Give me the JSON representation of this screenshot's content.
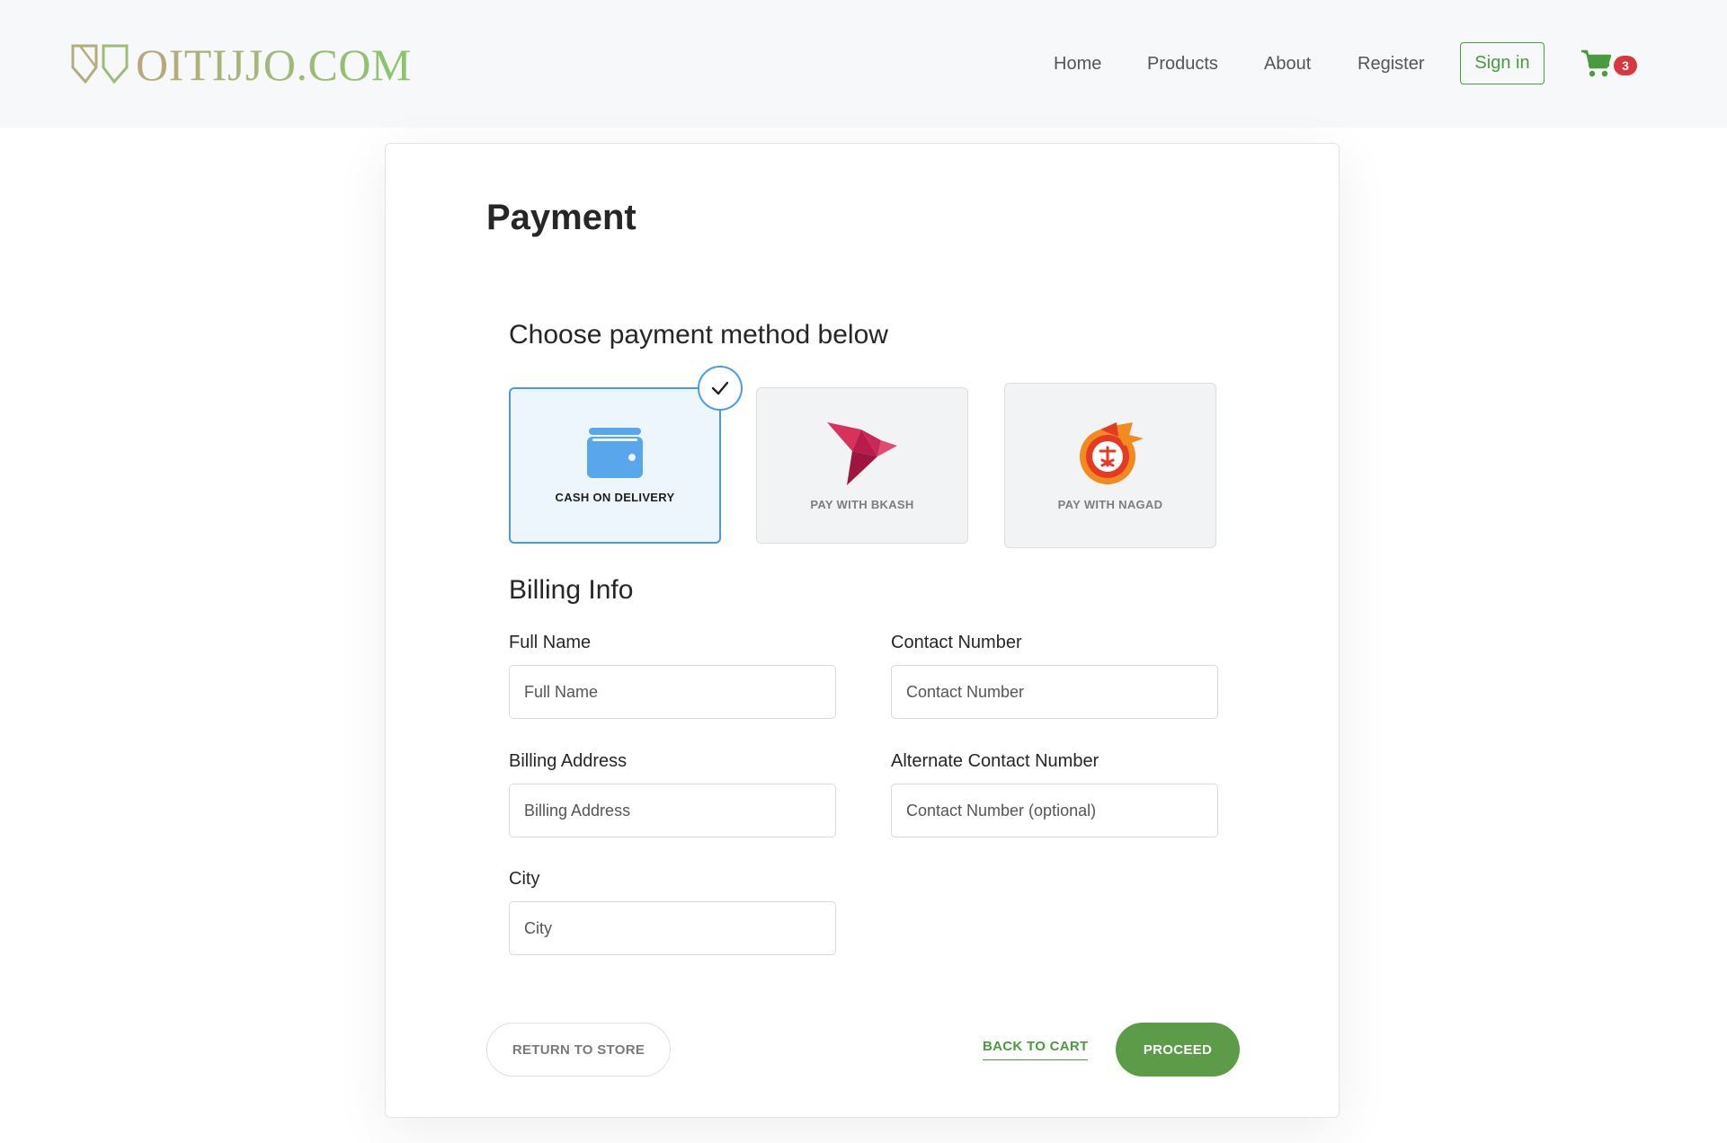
{
  "header": {
    "brand": "OITIJJO.COM",
    "nav": {
      "home": "Home",
      "products": "Products",
      "about": "About",
      "register": "Register"
    },
    "sign_in": "Sign in",
    "cart_count": "3",
    "brand_color": "#4a9a3e"
  },
  "payment": {
    "title": "Payment",
    "choose_title": "Choose payment method below",
    "options": [
      {
        "label": "CASH ON DELIVERY",
        "icon": "wallet-icon",
        "selected": true
      },
      {
        "label": "PAY WITH BKASH",
        "icon": "bkash-logo-icon",
        "selected": false
      },
      {
        "label": "PAY WITH NAGAD",
        "icon": "nagad-logo-icon",
        "selected": false
      }
    ],
    "selected_color": "#4a9ae3"
  },
  "billing": {
    "title": "Billing Info",
    "full_name": {
      "label": "Full Name",
      "placeholder": "Full Name"
    },
    "contact": {
      "label": "Contact Number",
      "placeholder": "Contact Number"
    },
    "address": {
      "label": "Billing Address",
      "placeholder": "Billing Address"
    },
    "alt_contact": {
      "label": "Alternate Contact Number",
      "placeholder": "Contact Number (optional)"
    },
    "city": {
      "label": "City",
      "placeholder": "City"
    }
  },
  "actions": {
    "return": "RETURN TO STORE",
    "back": "BACK TO CART",
    "proceed": "PROCEED",
    "proceed_color": "#5c9b47"
  }
}
